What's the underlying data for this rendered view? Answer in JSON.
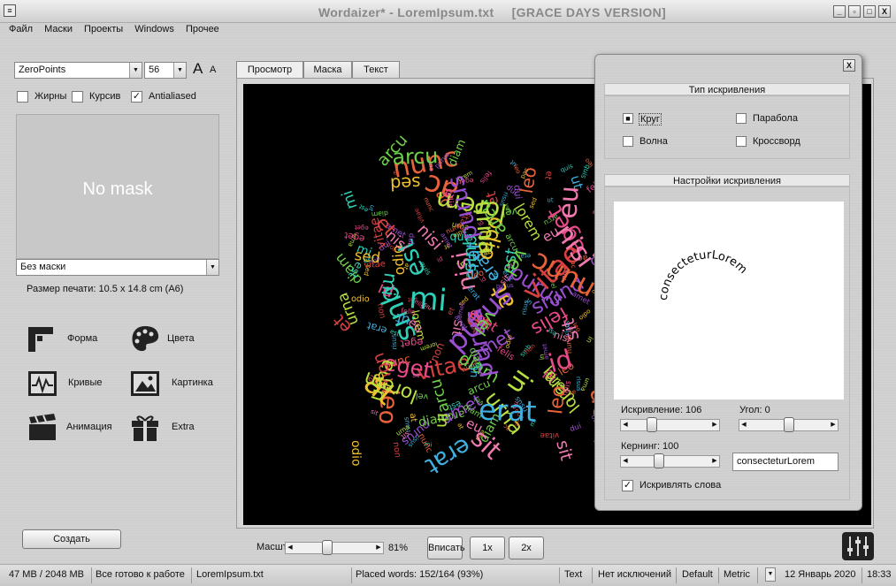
{
  "window": {
    "title_app": "Wordaizer* - LoremIpsum.txt",
    "title_edition": "[GRACE DAYS VERSION]",
    "minimize": "_",
    "maximize": "□",
    "close": "X"
  },
  "menu": [
    "Файл",
    "Маски",
    "Проекты",
    "Windows",
    "Прочее"
  ],
  "font_panel": {
    "font_name": "ZeroPoints",
    "font_size": "56",
    "bold_label": "Жирны",
    "italic_label": "Курсив",
    "antialiased_label": "Antialiased",
    "antialiased_checked": true,
    "grow_glyph": "A",
    "shrink_glyph": "A"
  },
  "mask": {
    "preview_text": "No mask",
    "select_value": "Без маски",
    "print_size": "Размер печати: 10.5 x 14.8 cm (A6)"
  },
  "tools": [
    {
      "label": "Форма",
      "icon": "ruler-shape-icon"
    },
    {
      "label": "Цвета",
      "icon": "palette-icon"
    },
    {
      "label": "Кривые",
      "icon": "curves-icon"
    },
    {
      "label": "Картинка",
      "icon": "picture-icon"
    },
    {
      "label": "Анимация",
      "icon": "clapperboard-icon"
    },
    {
      "label": "Extra",
      "icon": "gift-icon"
    }
  ],
  "create_button": "Создать",
  "tabs": [
    "Просмотр",
    "Маска",
    "Текст"
  ],
  "canvas_words": [
    "eget",
    "sed",
    "ut",
    "dui",
    "vel",
    "nunc",
    "quis",
    "sit",
    "non",
    "in",
    "id",
    "at",
    "erat",
    "amet",
    "diam",
    "ac",
    "est",
    "nisi",
    "vitae",
    "lorem",
    "felis",
    "odio",
    "risus",
    "purus",
    "arcu",
    "leo",
    "mi",
    "eu",
    "et",
    "urna"
  ],
  "canvas_colors": [
    "#e84a8a",
    "#f2c12e",
    "#3fb0e0",
    "#9a4fd0",
    "#6ed04a",
    "#e8623a",
    "#2fd0b8",
    "#f07ab0",
    "#d84040",
    "#b8e040"
  ],
  "bottom": {
    "zoom_label": "Масштаб",
    "zoom_value": "81%",
    "zoom_fraction": 0.4,
    "fit_button": "Вписать",
    "x1_button": "1x",
    "x2_button": "2x"
  },
  "status": {
    "memory": "47 MB / 2048 MB",
    "state": "Все готово к работе",
    "file": "LoremIpsum.txt",
    "placed": "Placed words: 152/164 (93%)",
    "mode": "Text",
    "exceptions": "Нет исключений",
    "default": "Default",
    "metric": "Metric",
    "date": "12 Январь 2020",
    "time": "18:33"
  },
  "warp": {
    "close": "X",
    "type_header": "Тип искривления",
    "types": [
      {
        "label": "Круг",
        "selected": true
      },
      {
        "label": "Парабола",
        "selected": false
      },
      {
        "label": "Волна",
        "selected": false
      },
      {
        "label": "Кроссворд",
        "selected": false
      }
    ],
    "settings_header": "Настройки искривления",
    "preview_word": "consecteturLorem",
    "warp_label": "Искривление: 106",
    "warp_fraction": 0.25,
    "angle_label": "Угол: 0",
    "angle_fraction": 0.5,
    "kerning_label": "Кернинг: 100",
    "kerning_fraction": 0.35,
    "text_value": "consecteturLorem",
    "warp_words_label": "Искривлять слова",
    "warp_words_checked": true
  }
}
